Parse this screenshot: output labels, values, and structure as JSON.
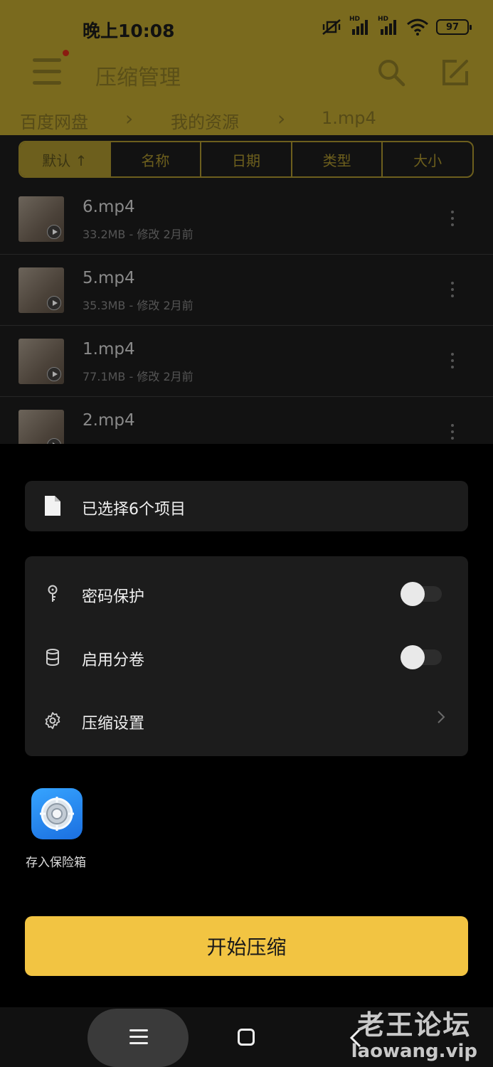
{
  "status_bar": {
    "time": "晚上10:08",
    "signal_1": "HD",
    "signal_2": "HD",
    "battery": "97"
  },
  "app_bar": {
    "title": "压缩管理",
    "menu_icon": "menu-icon",
    "search_icon": "search-icon",
    "edit_icon": "edit-icon"
  },
  "breadcrumb": [
    "百度网盘",
    "我的资源",
    "1.mp4"
  ],
  "sort_tabs": [
    "默认 ↑",
    "名称",
    "日期",
    "类型",
    "大小"
  ],
  "files": [
    {
      "name": "6.mp4",
      "meta": "33.2MB - 修改 2月前"
    },
    {
      "name": "5.mp4",
      "meta": "35.3MB - 修改 2月前"
    },
    {
      "name": "1.mp4",
      "meta": "77.1MB - 修改 2月前"
    },
    {
      "name": "2.mp4",
      "meta": ""
    }
  ],
  "sheet": {
    "selected_text": "已选择6个项目",
    "options": [
      {
        "label": "密码保护",
        "icon": "key-icon",
        "toggle": false
      },
      {
        "label": "启用分卷",
        "icon": "database-icon",
        "toggle": false
      },
      {
        "label": "压缩设置",
        "icon": "gear-icon"
      }
    ],
    "vault_label": "存入保险箱",
    "start_button": "开始压缩"
  },
  "watermark": {
    "cn": "老王论坛",
    "en": "laowang.vip"
  },
  "colors": {
    "accent": "#f2c442",
    "header_dim": "#7a6a1e",
    "card": "#1c1c1c",
    "vault_blue": "#2b8cf5"
  }
}
